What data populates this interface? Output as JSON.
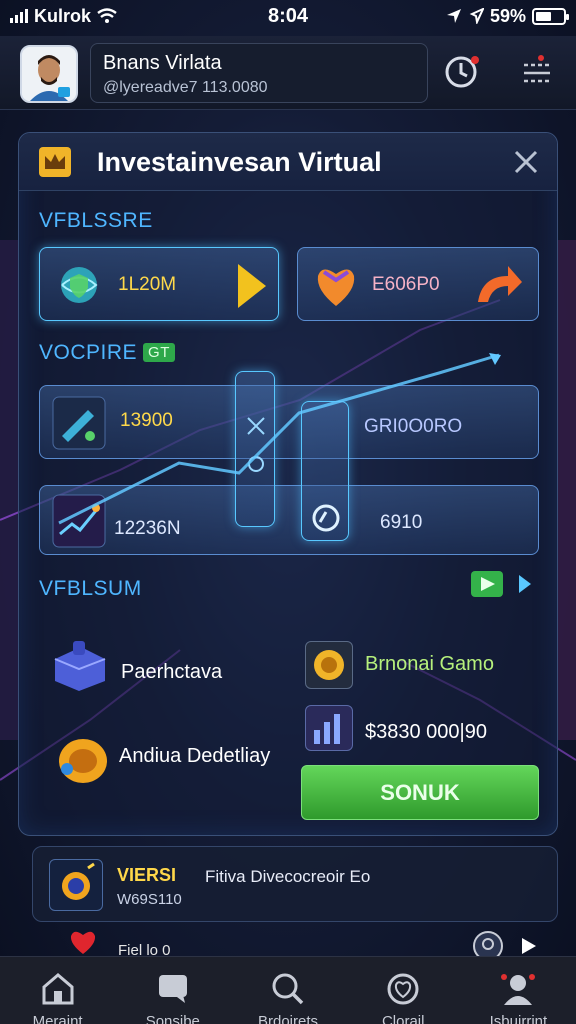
{
  "status_bar": {
    "carrier": "Kulrok",
    "time": "8:04",
    "battery": "59%",
    "battery_level": 0.59
  },
  "profile": {
    "name": "Bnans Virlata",
    "handle": "@lyereadve7 113.0080"
  },
  "panel": {
    "title": "Investainvesan Virtual",
    "section1_label": "VFBLSSRE",
    "card1_value": "1L20M",
    "card2_value": "E606P0",
    "section2_label": "VOCPIRE",
    "section2_badge": "GT",
    "card3_value": "13900",
    "card4_value": "GRI0O0RO",
    "card5_value": "12236N",
    "card6_value": "6910",
    "section3_label": "VFBLSUM",
    "feature1": "Paerhctava",
    "feature2": "Andiua Dedetliay",
    "feature3": "Brnonai Gamo",
    "feature4": "$3830 000|90",
    "cta_label": "SONUK"
  },
  "promo": {
    "title": "VIERSI",
    "text": "Fitiva Divecocreoir Eo",
    "sub": "W69S110"
  },
  "feed": {
    "text": "Fiel lo 0"
  },
  "nav": {
    "items": [
      "Meraint",
      "Sonsibe",
      "Brdoirets",
      "Clorail",
      "Isbuirrint"
    ]
  },
  "colors": {
    "accent_blue": "#4fb6ff",
    "accent_gold": "#ffd94a",
    "accent_green": "#2f9a2c",
    "heart_red": "#e0262e"
  }
}
